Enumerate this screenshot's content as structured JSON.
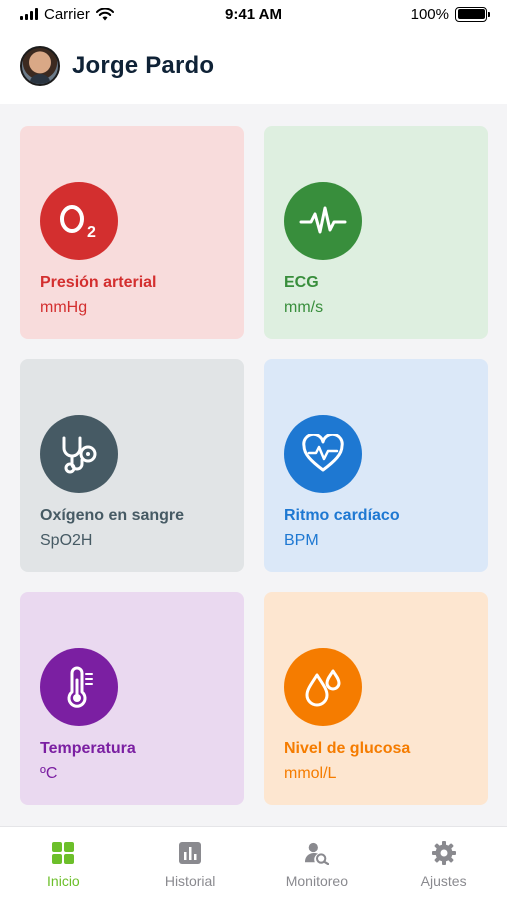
{
  "status_bar": {
    "carrier": "Carrier",
    "time": "9:41 AM",
    "battery": "100%"
  },
  "header": {
    "user_name": "Jorge Pardo"
  },
  "cards": [
    {
      "title": "Presión arterial",
      "unit": "mmHg",
      "icon": "o2-icon",
      "bg": "#f8dcdc",
      "circle": "#d32f2f",
      "text_color": "#d32f2f"
    },
    {
      "title": "ECG",
      "unit": "mm/s",
      "icon": "ecg-icon",
      "bg": "#deefe0",
      "circle": "#388e3c",
      "text_color": "#388e3c"
    },
    {
      "title": "Oxígeno en sangre",
      "unit": "SpO2H",
      "icon": "stethoscope-icon",
      "bg": "#e1e4e6",
      "circle": "#465a64",
      "text_color": "#465a64"
    },
    {
      "title": "Ritmo cardíaco",
      "unit": "BPM",
      "icon": "heart-rate-icon",
      "bg": "#dbe8f8",
      "circle": "#1e78d2",
      "text_color": "#1e78d2"
    },
    {
      "title": "Temperatura",
      "unit": "ºC",
      "icon": "thermometer-icon",
      "bg": "#ead9f0",
      "circle": "#7b1fa2",
      "text_color": "#7b1fa2"
    },
    {
      "title": "Nivel de glucosa",
      "unit": "mmol/L",
      "icon": "drops-icon",
      "bg": "#fde6d0",
      "circle": "#f57c00",
      "text_color": "#f57c00"
    }
  ],
  "nav": {
    "items": [
      {
        "label": "Inicio",
        "icon": "grid-icon",
        "active": true
      },
      {
        "label": "Historial",
        "icon": "chart-icon",
        "active": false
      },
      {
        "label": "Monitoreo",
        "icon": "user-search-icon",
        "active": false
      },
      {
        "label": "Ajustes",
        "icon": "gear-icon",
        "active": false
      }
    ],
    "active_color": "#6cbf2a",
    "inactive_color": "#8a8a8f"
  }
}
